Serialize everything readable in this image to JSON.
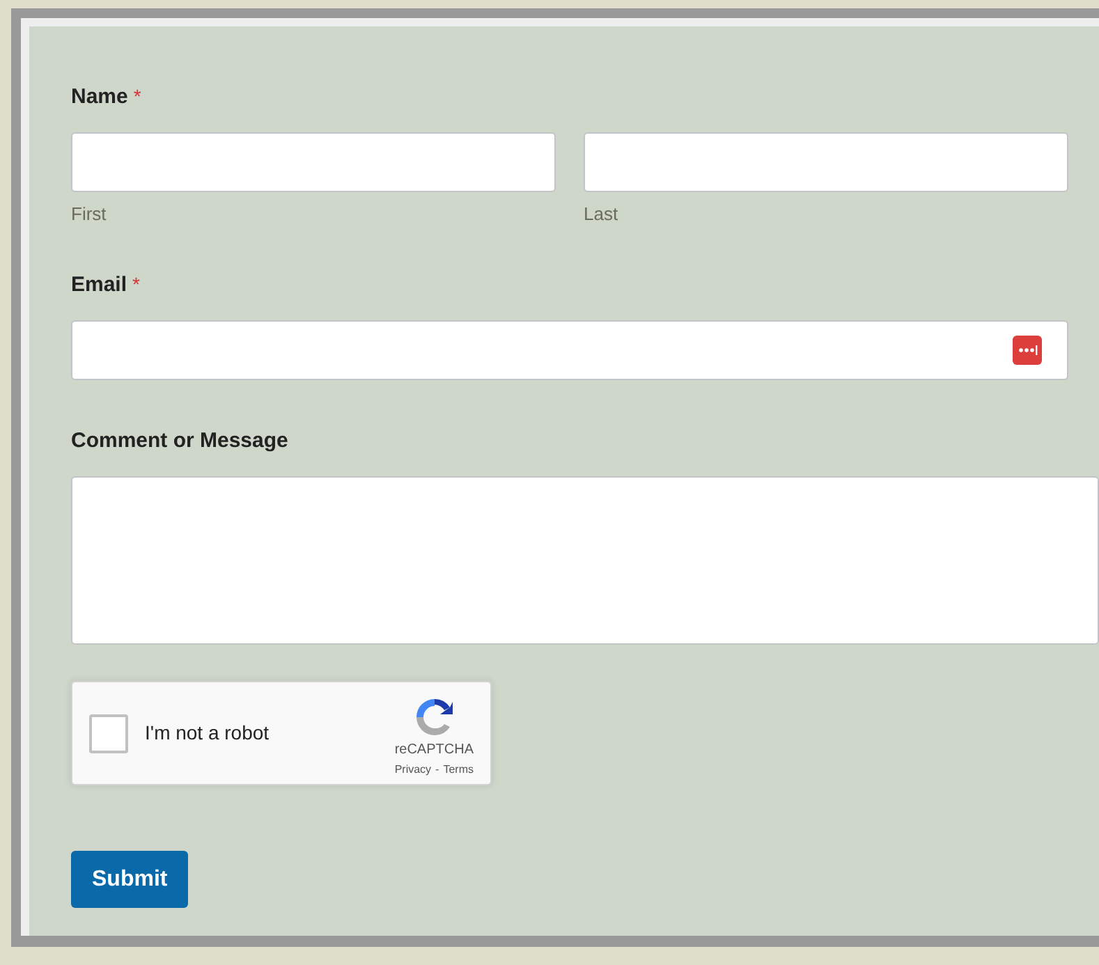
{
  "name_field": {
    "label": "Name",
    "required_mark": "*",
    "parts": [
      {
        "sublabel": "First"
      },
      {
        "sublabel": "Last"
      }
    ]
  },
  "email_field": {
    "label": "Email",
    "required_mark": "*"
  },
  "message_field": {
    "label": "Comment or Message"
  },
  "recaptcha": {
    "checked": false,
    "label": "I'm not a robot",
    "brand": "reCAPTCHA",
    "links": [
      "Privacy",
      "Terms"
    ],
    "separator": "-"
  },
  "submit_button": {
    "label": "Submit"
  }
}
